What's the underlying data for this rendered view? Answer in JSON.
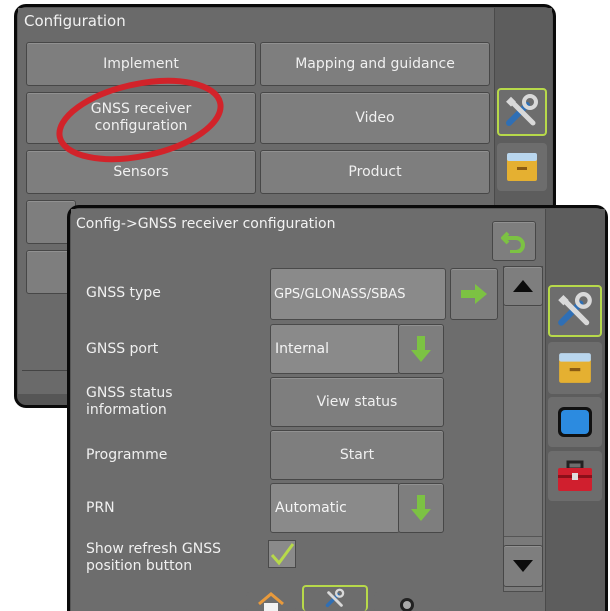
{
  "back_screen": {
    "title": "Configuration",
    "buttons": {
      "implement": "Implement",
      "mapping": "Mapping and guidance",
      "gnss": "GNSS receiver configuration",
      "video": "Video",
      "sensors": "Sensors",
      "product": "Product"
    }
  },
  "front_screen": {
    "title": "Config->GNSS receiver configuration",
    "rows": [
      {
        "label": "GNSS type",
        "value": "GPS/GLONASS/SBAS"
      },
      {
        "label": "GNSS port",
        "value": "Internal"
      },
      {
        "label": "GNSS status information",
        "value": "View status"
      },
      {
        "label": "Programme",
        "value": "Start"
      },
      {
        "label": "PRN",
        "value": "Automatic"
      },
      {
        "label": "Show refresh GNSS position button",
        "value": ""
      }
    ]
  },
  "icons": {
    "back": "back-arrow-icon",
    "next": "right-arrow-icon",
    "dropdown": "down-arrow-icon",
    "scroll_up": "scroll-up-icon",
    "scroll_down": "scroll-down-icon",
    "tools": "tools-icon",
    "drawer": "drawer-icon",
    "monitor": "monitor-icon",
    "toolbox": "toolbox-icon",
    "home": "home-icon",
    "camera": "camera-icon"
  },
  "colors": {
    "accent_green": "#7cc243",
    "selected_border": "#b7d94a",
    "highlight_circle": "#d2232a"
  }
}
